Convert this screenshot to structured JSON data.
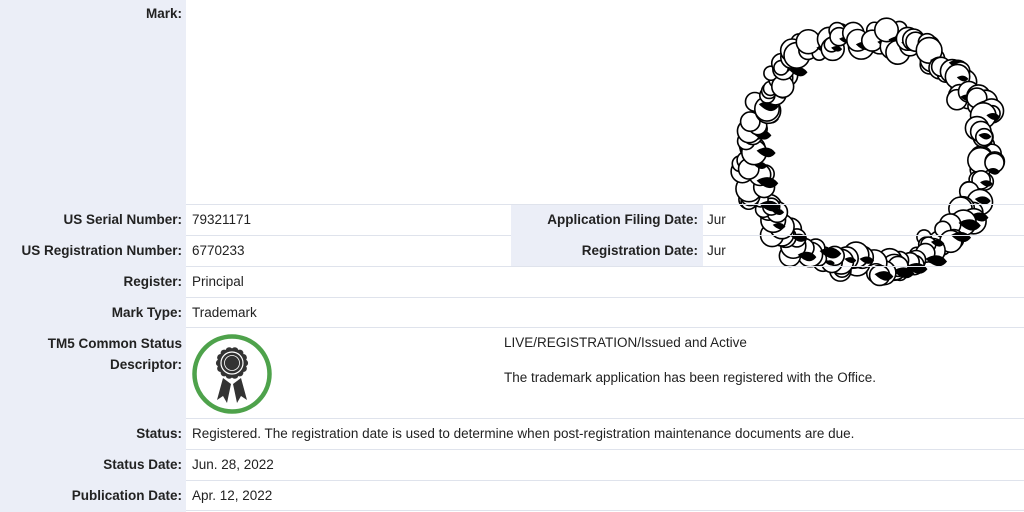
{
  "mark": {
    "label": "Mark:"
  },
  "rows": {
    "serial": {
      "label": "US Serial Number:",
      "value": "79321171"
    },
    "registration": {
      "label": "US Registration Number:",
      "value": "6770233"
    },
    "register": {
      "label": "Register:",
      "value": "Principal"
    },
    "mark_type": {
      "label": "Mark Type:",
      "value": "Trademark"
    },
    "tm5": {
      "label_line1": "TM5 Common Status",
      "label_line2": "Descriptor:",
      "status_line": "LIVE/REGISTRATION/Issued and Active",
      "description": "The trademark application has been registered with the Office."
    },
    "status": {
      "label": "Status:",
      "value": "Registered. The registration date is used to determine when post-registration maintenance documents are due."
    },
    "status_date": {
      "label": "Status Date:",
      "value": "Jun. 28, 2022"
    },
    "publication_date": {
      "label": "Publication Date:",
      "value": "Apr. 12, 2022"
    }
  },
  "dates": {
    "filing": {
      "label": "Application Filing Date:",
      "value": "Jur"
    },
    "registration": {
      "label": "Registration Date:",
      "value": "Jur"
    }
  },
  "icons": {
    "badge": "registered-ribbon-icon",
    "mark": "cotton-wreath-mark-image"
  },
  "colors": {
    "label_bg": "#ebeef7",
    "badge_ring": "#4ea24b",
    "badge_seal": "#333333"
  }
}
